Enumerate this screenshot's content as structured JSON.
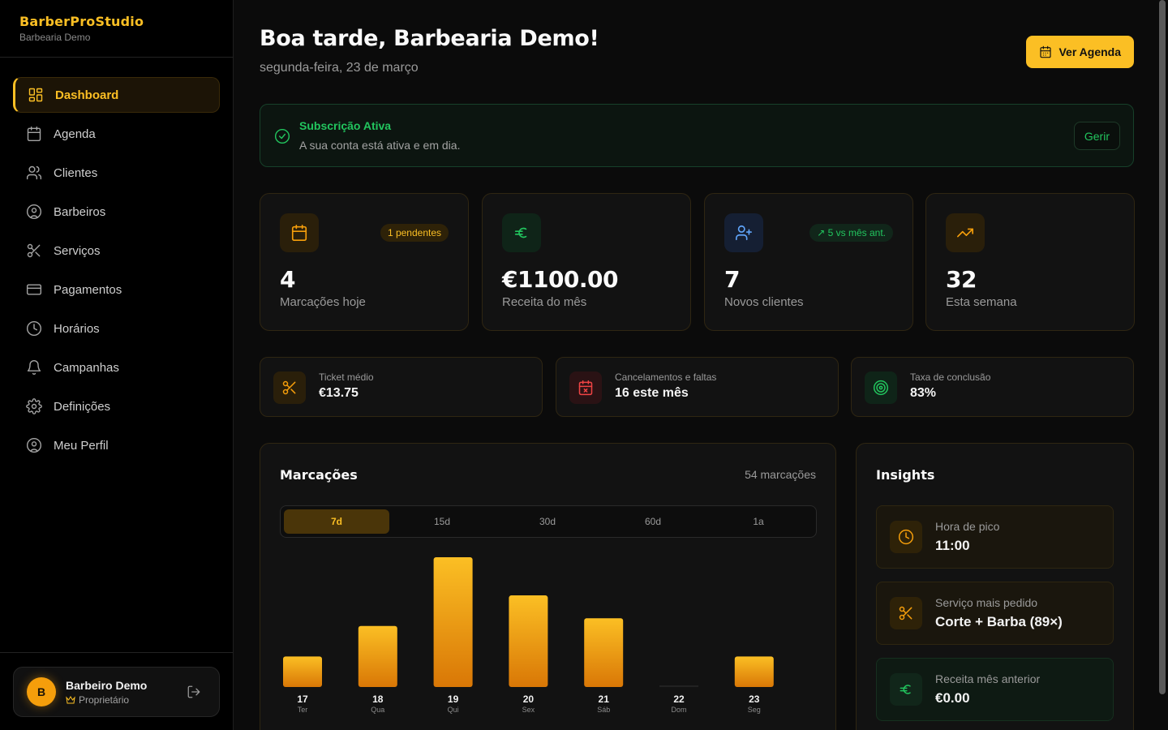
{
  "brand": {
    "title": "BarberProStudio",
    "subtitle": "Barbearia Demo"
  },
  "nav": [
    {
      "label": "Dashboard",
      "icon": "dashboard-icon",
      "active": true
    },
    {
      "label": "Agenda",
      "icon": "calendar-icon"
    },
    {
      "label": "Clientes",
      "icon": "users-icon"
    },
    {
      "label": "Barbeiros",
      "icon": "user-circle-icon"
    },
    {
      "label": "Serviços",
      "icon": "scissors-icon"
    },
    {
      "label": "Pagamentos",
      "icon": "credit-card-icon"
    },
    {
      "label": "Horários",
      "icon": "clock-icon"
    },
    {
      "label": "Campanhas",
      "icon": "bell-icon"
    },
    {
      "label": "Definições",
      "icon": "gear-icon"
    },
    {
      "label": "Meu Perfil",
      "icon": "user-circle-icon"
    }
  ],
  "user": {
    "initial": "B",
    "name": "Barbeiro Demo",
    "role": "Proprietário"
  },
  "header": {
    "greeting": "Boa tarde, Barbearia Demo!",
    "date": "segunda-feira, 23 de março",
    "agenda_button": "Ver Agenda"
  },
  "subscription": {
    "title": "Subscrição Ativa",
    "text": "A sua conta está ativa e em dia.",
    "manage_button": "Gerir"
  },
  "stats": [
    {
      "value": "4",
      "label": "Marcações hoje",
      "badge": "1 pendentes",
      "icon": "calendar-icon"
    },
    {
      "value": "€1100.00",
      "label": "Receita do mês",
      "badge": "",
      "icon": "euro-icon"
    },
    {
      "value": "7",
      "label": "Novos clientes",
      "badge": "↗ 5 vs mês ant.",
      "icon": "user-plus-icon"
    },
    {
      "value": "32",
      "label": "Esta semana",
      "badge": "",
      "icon": "trending-up-icon"
    }
  ],
  "mini_stats": [
    {
      "label": "Ticket médio",
      "value": "€13.75",
      "icon": "scissors-icon"
    },
    {
      "label": "Cancelamentos e faltas",
      "value": "16 este mês",
      "icon": "calendar-x-icon"
    },
    {
      "label": "Taxa de conclusão",
      "value": "83%",
      "icon": "target-icon"
    }
  ],
  "chart": {
    "title": "Marcações",
    "count_label": "54 marcações",
    "ranges": [
      "7d",
      "15d",
      "30d",
      "60d",
      "1a"
    ],
    "active_range": "7d"
  },
  "chart_data": {
    "type": "bar",
    "categories": [
      "17",
      "18",
      "19",
      "20",
      "21",
      "22",
      "23"
    ],
    "weekdays": [
      "Ter",
      "Qua",
      "Qui",
      "Sex",
      "Sáb",
      "Dom",
      "Seg"
    ],
    "values": [
      4,
      8,
      17,
      12,
      9,
      0,
      4
    ],
    "title": "Marcações",
    "ylim": [
      0,
      17
    ]
  },
  "insights": {
    "title": "Insights",
    "items": [
      {
        "label": "Hora de pico",
        "value": "11:00",
        "icon": "clock-icon"
      },
      {
        "label": "Serviço mais pedido",
        "value": "Corte + Barba (89×)",
        "icon": "scissors-icon"
      },
      {
        "label": "Receita mês anterior",
        "value": "€0.00",
        "icon": "euro-icon"
      }
    ]
  },
  "colors": {
    "accent": "#fbbf24",
    "success": "#22c55e",
    "danger": "#ef4444",
    "info": "#60a5fa"
  }
}
